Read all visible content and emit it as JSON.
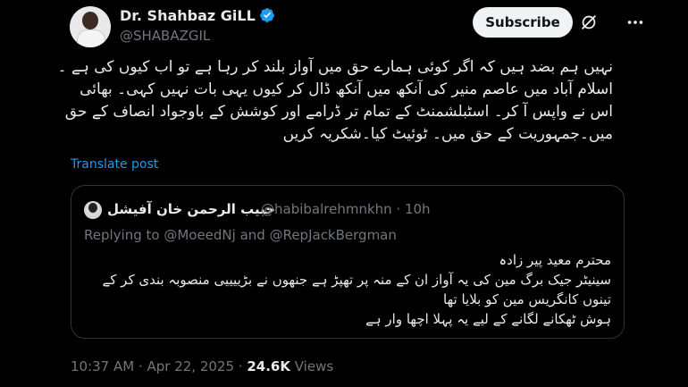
{
  "author": {
    "name": "Dr. Shahbaz GiLL",
    "handle": "@SHABAZGIL",
    "avatar_icon": "profile-photo",
    "verified_color": "#1d9bf0"
  },
  "actions": {
    "subscribe_label": "Subscribe",
    "grok_icon": "grok-icon",
    "more_icon": "more-icon"
  },
  "tweet": {
    "lines": [
      "نہیں ہم بضد ہیں کہ اگر کوئی ہمارے حق میں آواز بلند کر رہا ہے تو اب کیوں کی ہے ۔",
      "اسلام آباد میں عاصم منیر کی آنکھ میں آنکھ ڈال کر کیوں یہی بات نہیں کہی۔ بھائی",
      "اس نے واپس آ کر۔ اسٹبلشمنٹ کے تمام تر ڈرامے اور کوشش کے باوجواد انصاف کے حق",
      "میں۔جمہوریت کے حق میں۔ ٹوئیٹ کیا۔شکریہ کریں"
    ],
    "translate_label": "Translate post"
  },
  "quote": {
    "name": "حبیب الرحمن خان آفیشل",
    "handle_time": "@habibalrehmnkhn · 10h",
    "replying_to": "Replying to @MoeedNj and @RepJackBergman",
    "lines": [
      "محترم معید پیر زادہ",
      "سینیٹر جیک برگ مین کی یہ آواز ان کے منہ پر تھپڑ ہے جنھوں نے بڑییییی منصوبہ بندی کر کے",
      "تینوں کانگریس مین کو بلایا تھا",
      "ہوش ٹھکانے لگانے کے لیے یہ پہلا اچھا وار ہے"
    ]
  },
  "meta": {
    "time_date": "10:37 AM · Apr 22, 2025 · ",
    "views_count": "24.6K",
    "views_label": " Views"
  }
}
